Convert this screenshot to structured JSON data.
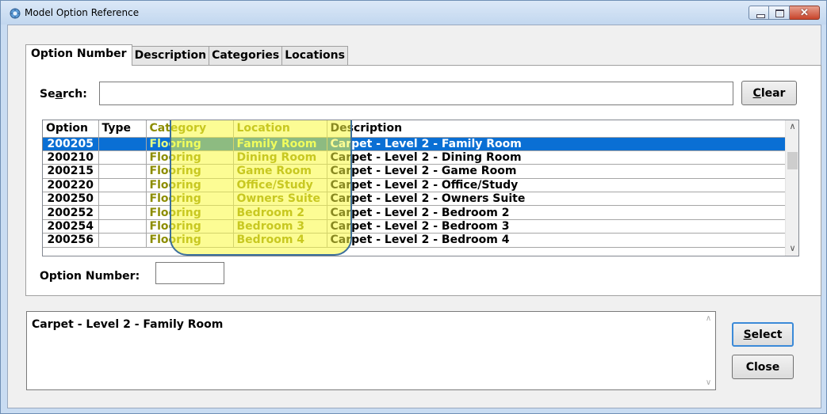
{
  "window": {
    "title": "Model Option Reference",
    "close_glyph": "✕"
  },
  "tabs": [
    {
      "label": "Option Number",
      "active": true
    },
    {
      "label": "Description",
      "active": false
    },
    {
      "label": "Categories",
      "active": false
    },
    {
      "label": "Locations",
      "active": false
    }
  ],
  "search": {
    "label_pre": "Se",
    "label_ul": "a",
    "label_post": "rch:",
    "value": ""
  },
  "clear_button": {
    "ul": "C",
    "rest": "lear"
  },
  "grid": {
    "columns": [
      "Option",
      "Type",
      "Category",
      "Location",
      "Description"
    ],
    "rows": [
      [
        "200205",
        "",
        "Flooring",
        "Family Room",
        "Carpet - Level 2 - Family Room"
      ],
      [
        "200210",
        "",
        "Flooring",
        "Dining Room",
        "Carpet - Level 2 - Dining Room"
      ],
      [
        "200215",
        "",
        "Flooring",
        "Game Room",
        "Carpet - Level 2 - Game Room"
      ],
      [
        "200220",
        "",
        "Flooring",
        "Office/Study",
        "Carpet - Level 2 - Office/Study"
      ],
      [
        "200250",
        "",
        "Flooring",
        "Owners Suite",
        "Carpet - Level 2 - Owners Suite"
      ],
      [
        "200252",
        "",
        "Flooring",
        "Bedroom 2",
        "Carpet - Level 2 - Bedroom 2"
      ],
      [
        "200254",
        "",
        "Flooring",
        "Bedroom 3",
        "Carpet - Level 2 - Bedroom 3"
      ],
      [
        "200256",
        "",
        "Flooring",
        "Bedroom 4",
        "Carpet - Level 2 - Bedroom 4"
      ]
    ],
    "selected_row": 0,
    "highlight_color": "#fafa3c"
  },
  "option_number": {
    "label": "Option Number:",
    "value": ""
  },
  "description_text": "Carpet - Level 2 - Family Room",
  "select_button": {
    "ul": "S",
    "rest": "elect"
  },
  "close_button": "Close",
  "colors": {
    "selection": "#0a6fd4",
    "title_bar": "#c9dcf2",
    "close_button": "#c8442b"
  }
}
